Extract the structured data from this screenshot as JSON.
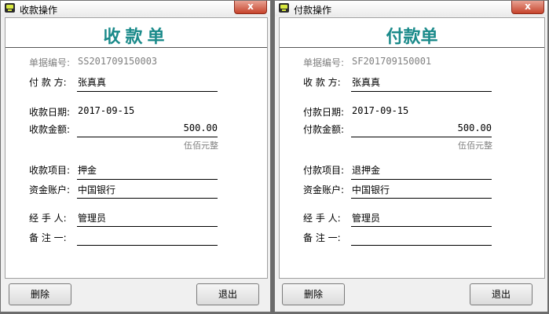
{
  "receipt": {
    "window_title": "收款操作",
    "close_glyph": "x",
    "doc_title": "收款单",
    "doc_no_label": "单据编号:",
    "doc_no_value": "SS201709150003",
    "party_label": "付 款 方:",
    "party_value": "张真真",
    "date_label": "收款日期:",
    "date_value": "2017-09-15",
    "amount_label": "收款金额:",
    "amount_value": "500.00",
    "amount_capital": "伍佰元整",
    "item_label": "收款项目:",
    "item_value": "押金",
    "account_label": "资金账户:",
    "account_value": "中国银行",
    "handler_label": "经 手 人:",
    "handler_value": "管理员",
    "remark_label": "备 注 一:",
    "remark_value": "",
    "delete_button": "删除",
    "exit_button": "退出"
  },
  "payment": {
    "window_title": "付款操作",
    "close_glyph": "x",
    "doc_title": "付款单",
    "doc_no_label": "单据编号:",
    "doc_no_value": "SF201709150001",
    "party_label": "收 款 方:",
    "party_value": "张真真",
    "date_label": "付款日期:",
    "date_value": "2017-09-15",
    "amount_label": "付款金额:",
    "amount_value": "500.00",
    "amount_capital": "伍佰元整",
    "item_label": "付款项目:",
    "item_value": "退押金",
    "account_label": "资金账户:",
    "account_value": "中国银行",
    "handler_label": "经 手 人:",
    "handler_value": "管理员",
    "remark_label": "备 注 一:",
    "remark_value": "",
    "delete_button": "删除",
    "exit_button": "退出"
  },
  "colors": {
    "title_accent": "#1a8a8a",
    "close_button": "#c7442c",
    "muted_text": "#808080"
  }
}
